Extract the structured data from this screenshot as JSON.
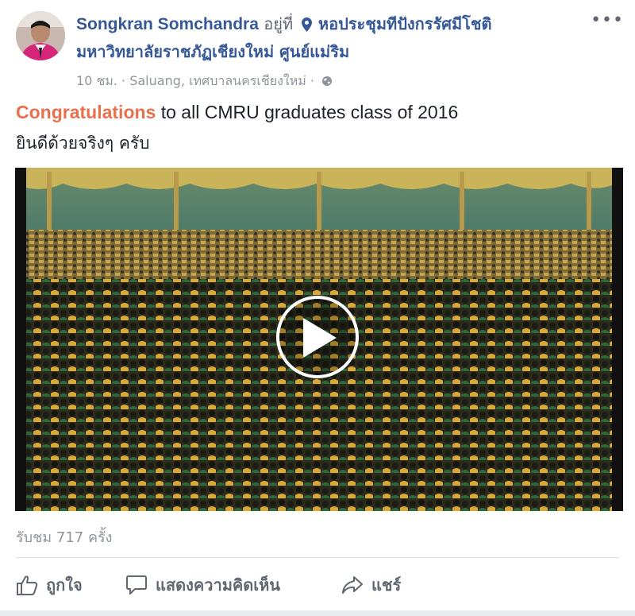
{
  "post": {
    "author": "Songkran Somchandra",
    "at_label": "อยู่ที่",
    "place_line1": "หอประชุมทีปังกรรัศมีโชติ",
    "place_line2": "มหาวิทยาลัยราชภัฏเชียงใหม่ ศูนย์แม่ริม",
    "time": "10 ชม.",
    "separator": "·",
    "location": "Saluang, เทศบาลนครเชียงใหม่",
    "separator2": "·",
    "more": "•••",
    "text_highlight": "Congratulations",
    "text_rest": " to all CMRU graduates class of 2016",
    "text_thai": "ยินดีด้วยจริงๆ ครับ",
    "views": "รับชม 717 ครั้ง"
  },
  "actions": {
    "like": "ถูกใจ",
    "comment": "แสดงความคิดเห็น",
    "share": "แชร์"
  },
  "icons": {
    "pin": "location-pin-icon",
    "globe": "globe-icon",
    "play": "play-icon",
    "like": "thumbs-up-icon",
    "comment": "comment-bubble-icon",
    "share": "share-arrow-icon"
  },
  "colors": {
    "author": "#365899",
    "highlight": "#e9704c",
    "meta": "#90949c"
  }
}
